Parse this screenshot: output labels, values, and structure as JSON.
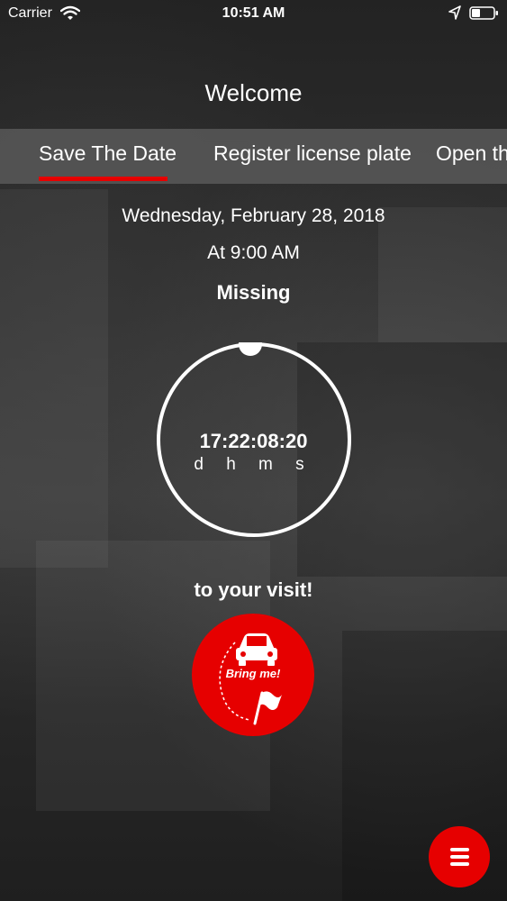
{
  "status_bar": {
    "carrier": "Carrier",
    "time": "10:51 AM",
    "icons": [
      "wifi-icon",
      "location-arrow-icon",
      "battery-icon"
    ]
  },
  "header": {
    "title": "Welcome"
  },
  "tabs": [
    {
      "label": "Save The Date",
      "active": true
    },
    {
      "label": "Register license plate",
      "active": false
    },
    {
      "label": "Open th",
      "active": false
    }
  ],
  "event": {
    "date": "Wednesday, February 28, 2018",
    "time": "At 9:00 AM",
    "missing_label": "Missing",
    "countdown": "17:22:08:20",
    "units": "d h m s",
    "suffix": "to your visit!"
  },
  "actions": {
    "bring_me_label": "Bring me!",
    "bring_me_icons": [
      "car-icon",
      "flag-icon"
    ],
    "menu_icon": "hamburger-menu-icon"
  },
  "colors": {
    "accent": "#e60000",
    "tab_bar": "#5a5a5a",
    "text": "#ffffff"
  }
}
